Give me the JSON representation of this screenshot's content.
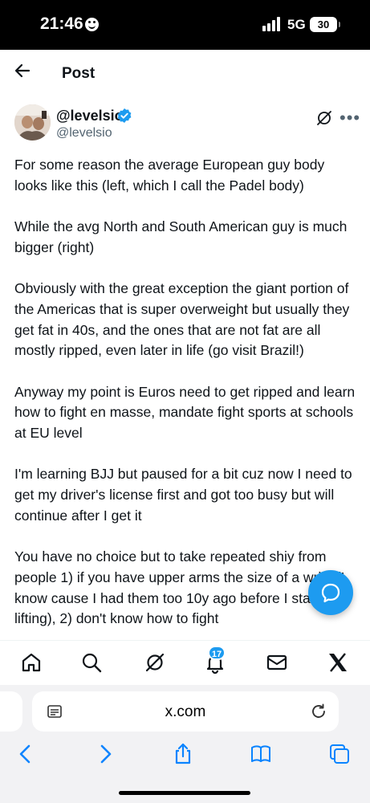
{
  "status_bar": {
    "time": "21:46",
    "network": "5G",
    "battery": "30"
  },
  "header": {
    "title": "Post"
  },
  "author": {
    "display_name": "@levelsio",
    "handle": "@levelsio"
  },
  "tweet": {
    "paragraphs": [
      "For some reason the average European guy body looks like this (left, which I call the Padel body)",
      "While the avg North and South American guy is much bigger (right)",
      "Obviously with the great exception the giant portion of the Americas that is super overweight but usually they get fat in 40s, and the ones that are not fat are all mostly ripped, even later in life (go visit Brazil!)",
      "Anyway my point is Euros need to get ripped and learn how to fight en masse, mandate fight sports at schools at EU level",
      "I'm learning BJJ but paused for a bit cuz now I need to get my driver's license first and got too busy but will continue after I get it",
      "You have no choice but to take repeated shiy from people 1) if you have upper arms the size of a wrist (I know cause I had them too 10y ago before I started lifting), 2) don't know how to fight"
    ]
  },
  "tab_bar": {
    "notifications_badge": "17"
  },
  "browser": {
    "url": "x.com"
  },
  "colors": {
    "accent": "#1d9bf0",
    "text": "#0f1419",
    "secondary": "#536471",
    "safari_blue": "#0a84ff"
  },
  "icons": [
    "back-arrow-icon",
    "verified-icon",
    "grok-icon",
    "more-icon",
    "compose-message-icon",
    "home-icon",
    "search-icon",
    "grok-icon",
    "bell-icon",
    "mail-icon",
    "x-logo-icon",
    "reader-icon",
    "reload-icon",
    "chevron-left-icon",
    "chevron-right-icon",
    "share-icon",
    "book-icon",
    "tabs-icon"
  ]
}
